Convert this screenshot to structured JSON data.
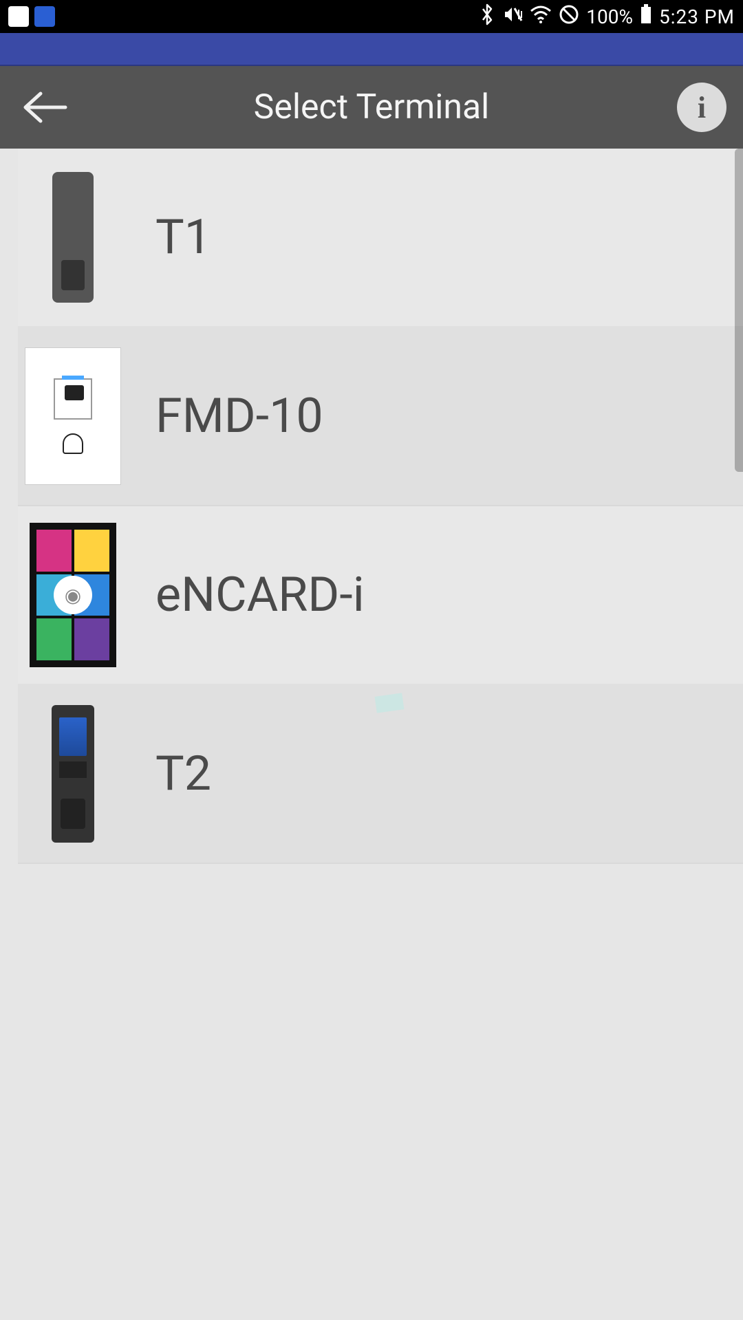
{
  "status_bar": {
    "battery_percent": "100%",
    "time": "5:23 PM"
  },
  "header": {
    "title": "Select Terminal"
  },
  "terminals": [
    {
      "label": "T1"
    },
    {
      "label": "FMD-10"
    },
    {
      "label": "eNCARD-i"
    },
    {
      "label": "T2"
    }
  ]
}
